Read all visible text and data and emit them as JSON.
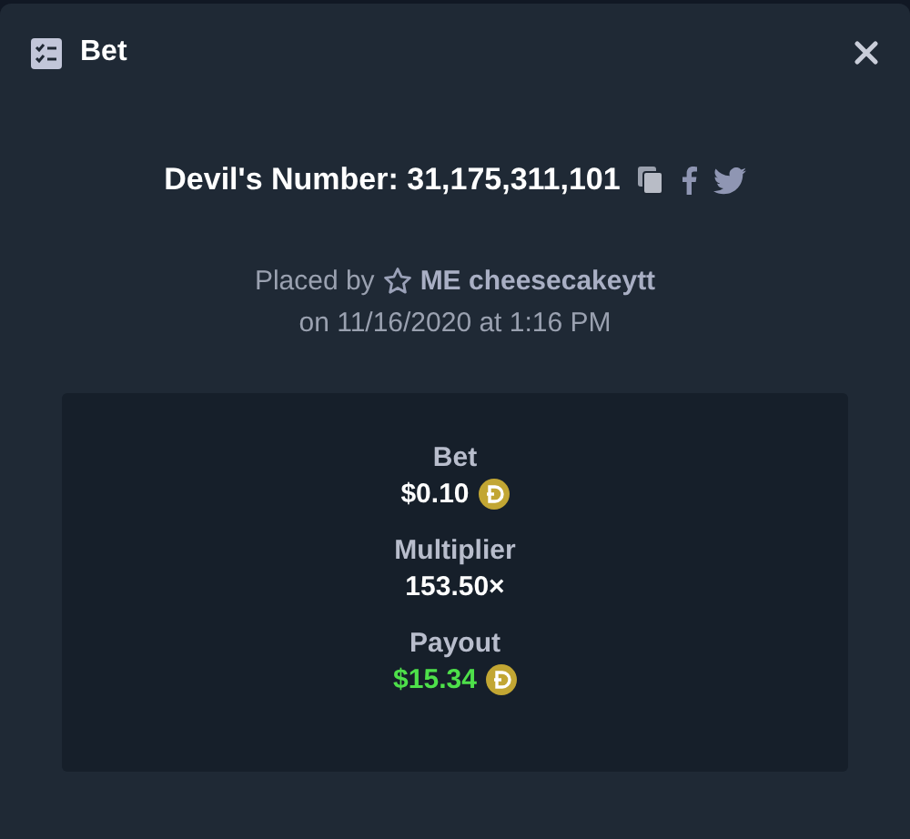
{
  "dialog": {
    "title": "Bet"
  },
  "headline": {
    "label": "Devil's Number:",
    "number": "31,175,311,101"
  },
  "placed_by": {
    "prefix": "Placed by",
    "user": "ME cheesecakeytt",
    "date": "on 11/16/2020 at 1:16 PM"
  },
  "stats": [
    {
      "label": "Bet",
      "value": "$0.10",
      "currency": true,
      "highlight": false
    },
    {
      "label": "Multiplier",
      "value": "153.50×",
      "currency": false,
      "highlight": false
    },
    {
      "label": "Payout",
      "value": "$15.34",
      "currency": true,
      "highlight": true
    }
  ]
}
